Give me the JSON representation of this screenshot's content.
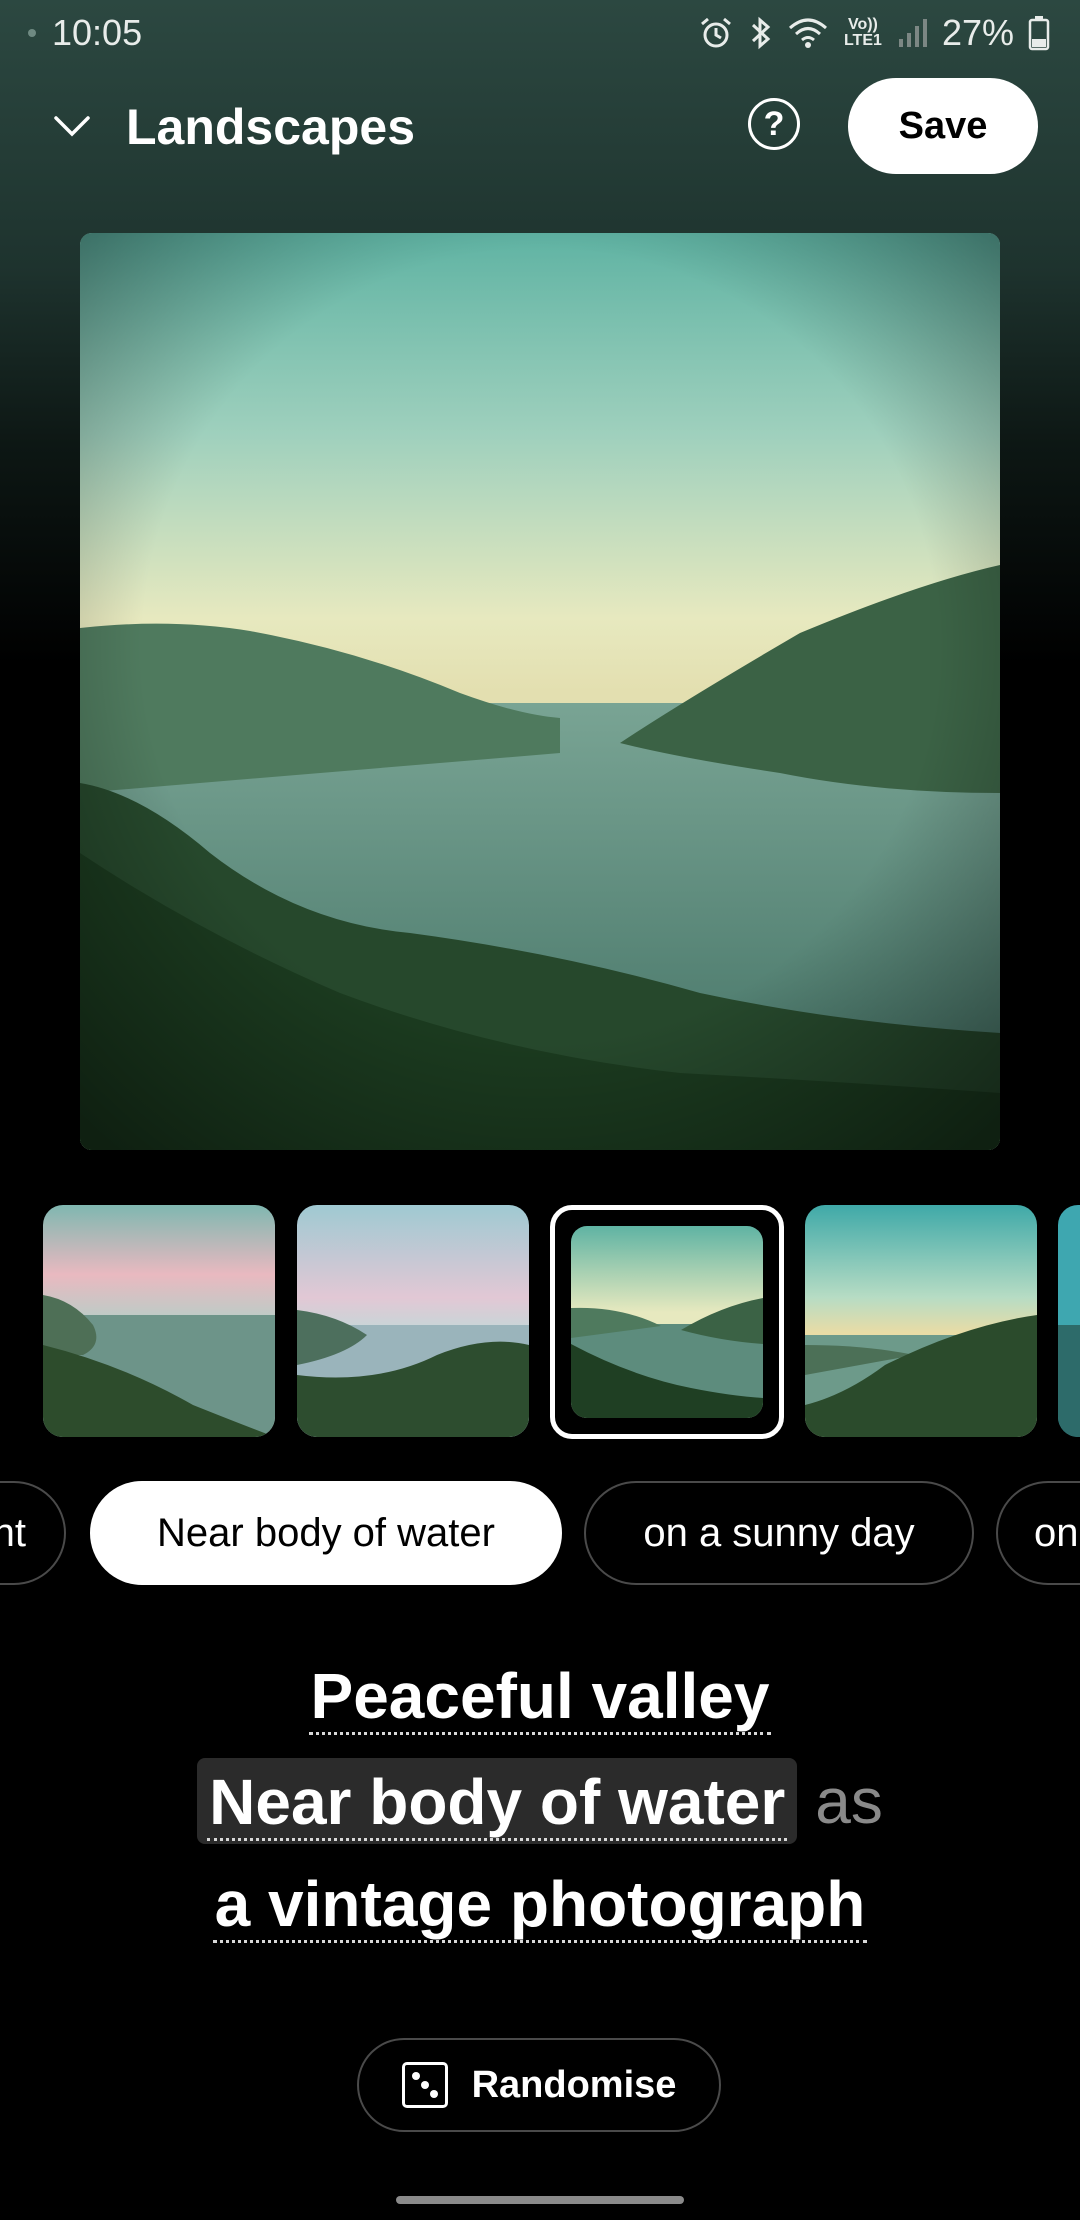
{
  "status_bar": {
    "time": "10:05",
    "network": "Vo)) LTE1",
    "battery": "27%",
    "icons": [
      "alarm-icon",
      "bluetooth-icon",
      "wifi-icon",
      "signal-icon",
      "battery-icon"
    ]
  },
  "header": {
    "title": "Landscapes",
    "help_icon": "?",
    "save_label": "Save"
  },
  "thumbnails": {
    "selected_index": 2,
    "items": [
      "pink-haze lake",
      "pastel inlet",
      "teal valley lake",
      "sunlit valley",
      "teal bay"
    ]
  },
  "chips": [
    {
      "label": "nt",
      "active": false
    },
    {
      "label": "Near body of water",
      "active": true
    },
    {
      "label": "on a sunny day",
      "active": false
    },
    {
      "label": "on",
      "active": false
    }
  ],
  "prompt": {
    "subject": "Peaceful valley",
    "modifier": "Near body of water",
    "connector": "as",
    "style": "a vintage photograph"
  },
  "randomise_label": "Randomise",
  "colors": {
    "accent": "#ffffff",
    "background": "#000000",
    "chip_border": "#4a4a4a",
    "highlight": "#2b2b2b"
  }
}
